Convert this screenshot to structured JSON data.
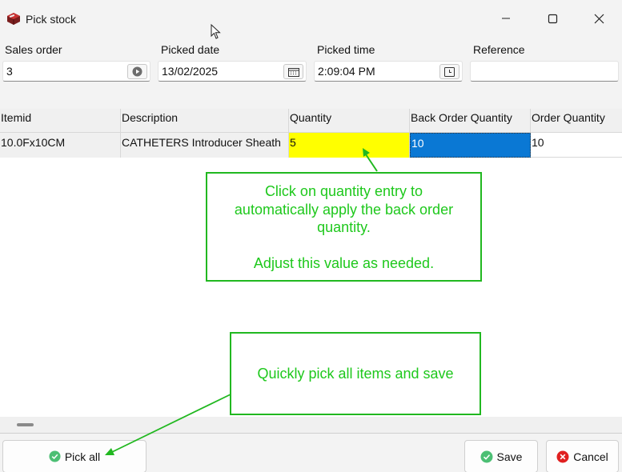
{
  "window": {
    "title": "Pick stock",
    "icons": {
      "app": "cash-register-icon",
      "minimize": "minimize-icon",
      "maximize": "maximize-icon",
      "close": "close-icon"
    }
  },
  "form": {
    "sales_order": {
      "label": "Sales order",
      "value": "3",
      "icon": "play-circle-icon"
    },
    "picked_date": {
      "label": "Picked date",
      "value": "13/02/2025",
      "icon": "calendar-icon"
    },
    "picked_time": {
      "label": "Picked time",
      "value": "2:09:04 PM",
      "icon": "clock-icon"
    },
    "reference": {
      "label": "Reference",
      "value": ""
    }
  },
  "grid": {
    "columns": [
      "Itemid",
      "Description",
      "Quantity",
      "Back Order Quantity",
      "Order Quantity"
    ],
    "rows": [
      {
        "itemid": "10.0Fx10CM",
        "description": "CATHETERS Introducer Sheath",
        "quantity": "5",
        "back_order_quantity": "10",
        "order_quantity": "10"
      }
    ]
  },
  "annotations": {
    "quantity_tip": {
      "line1": "Click on quantity entry to",
      "line2": "automatically apply the back order",
      "line3": "quantity.",
      "line4": "Adjust this value as needed."
    },
    "pick_all_tip": "Quickly pick all items and save",
    "color": "#21b820"
  },
  "buttons": {
    "pick_all": "Pick all",
    "save": "Save",
    "cancel": "Cancel"
  },
  "colors": {
    "quantity_cell": "#ffff00",
    "selected_cell": "#0a78d4",
    "ok_icon": "#4cbf74",
    "cancel_icon": "#e02020"
  }
}
